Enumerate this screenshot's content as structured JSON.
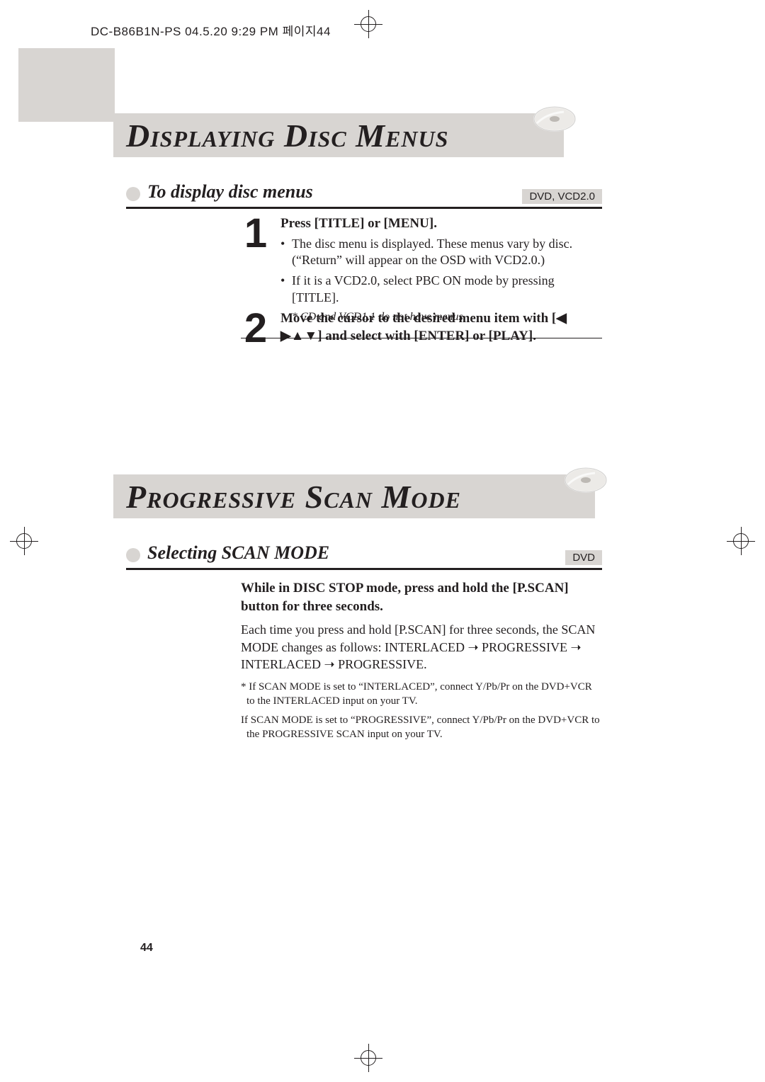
{
  "header_line": "DC-B86B1N-PS  04.5.20 9:29 PM  페이지44",
  "title1": "Displaying Disc Menus",
  "sub1": {
    "label": "To display disc menus",
    "tag": "DVD, VCD2.0"
  },
  "step1": {
    "num": "1",
    "heading": "Press [TITLE] or [MENU].",
    "b1": "The disc menu is displayed. These menus vary by disc. (“Return” will appear on the OSD with VCD2.0.)",
    "b2": "If it is a VCD2.0, select  PBC ON mode by pressing [TITLE].",
    "note": "* CD and VCD1.1 do not have menus."
  },
  "step2": {
    "num": "2",
    "line_a": "Move the cursor to the desired menu item with [",
    "arrows": "◀ ▶▲▼",
    "line_b": "] and select with [ENTER] or [PLAY]."
  },
  "title2": "Progressive Scan Mode",
  "sub2": {
    "label": "Selecting SCAN MODE",
    "tag": "DVD"
  },
  "prog": {
    "heading": "While in DISC STOP mode, press and hold the [P.SCAN] button for three seconds.",
    "body": "Each time you press and hold [P.SCAN] for three seconds, the SCAN MODE changes as follows: INTERLACED ➝ PROGRESSIVE ➝ INTERLACED ➝ PROGRESSIVE.",
    "note1": "* If SCAN MODE is set to “INTERLACED”, connect Y/Pb/Pr on the DVD+VCR to the INTERLACED input on your TV.",
    "note2": "If SCAN MODE is set to “PROGRESSIVE”, connect Y/Pb/Pr on the DVD+VCR to the PROGRESSIVE SCAN input on your TV."
  },
  "page_number": "44"
}
